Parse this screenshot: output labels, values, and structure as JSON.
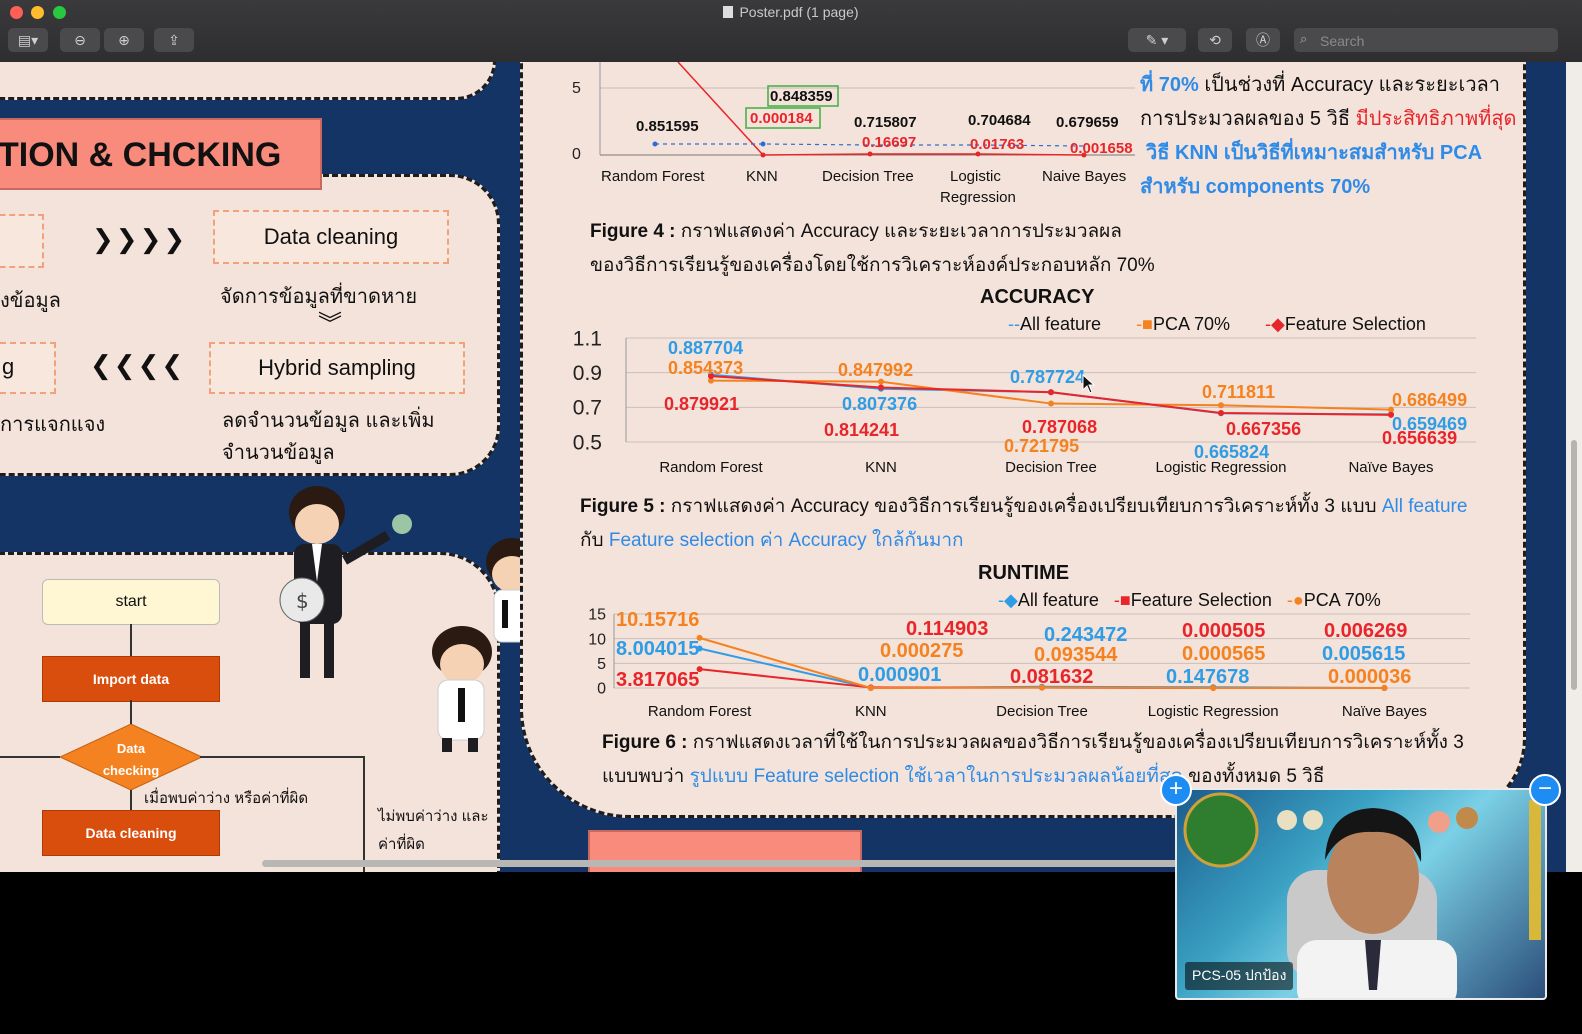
{
  "window": {
    "title": "Poster.pdf (1 page)",
    "search_placeholder": "Search"
  },
  "colors": {
    "accent_red": "#e8252a",
    "accent_blue": "#2e8be8",
    "pdf_navy": "#133464",
    "panel_bg": "#f4e3da",
    "orange": "#f58220",
    "flow_orange": "#d94e0d"
  },
  "left_panel": {
    "section_title": "TION & CHCKING",
    "arrows_right": "❯❯❯❯",
    "arrows_left": "❮❮❮❮",
    "data_cleaning_box": "Data cleaning",
    "data_cleaning_desc": "จัดการข้อมูลที่ขาดหาย",
    "hybrid_box": "Hybrid sampling",
    "hybrid_desc_1": "ลดจำนวนข้อมูล และเพิ่ม",
    "hybrid_desc_2": "จำนวนข้อมูล",
    "left_cut_1": "งข้อมูล",
    "left_cut_2": "g",
    "left_cut_3": "การแจกแจง"
  },
  "flowchart": {
    "start": "start",
    "import": "Import data",
    "checking": "Data checking",
    "found_label": "เมื่อพบค่าว่าง หรือค่าที่ผิด",
    "notfound_label_1": "ไม่พบค่าว่าง และ",
    "notfound_label_2": "ค่าที่ผิด",
    "cleaning": "Data cleaning"
  },
  "fig4": {
    "caption_bold": "Figure 4 :",
    "caption_1": " กราฟแสดงค่า Accuracy และระยะเวลาการประมวลผล",
    "caption_2": "ของวิธีการเรียนรู้ของเครื่องโดยใช้การวิเคราะห์องค์ประกอบหลัก 70%",
    "side_1_blue": "ที่ 70%",
    "side_1_black": " เป็นช่วงที่ Accuracy และระยะเวลา",
    "side_2_black": "การประมวลผลของ 5 วิธี ",
    "side_2_red": "มีประสิทธิภาพที่สุด",
    "side_3": "วิธี KNN เป็นวิธีที่เหมาะสมสำหรับ PCA",
    "side_4": "สำหรับ components 70%",
    "ytick_5": "5",
    "ytick_0": "0",
    "labels_black": [
      "0.851595",
      "0.848359",
      "0.715807",
      "0.704684",
      "0.679659"
    ],
    "labels_red": [
      "0.000184",
      "0.16697",
      "0.01763",
      "0.001658"
    ],
    "categories": [
      "Random Forest",
      "KNN",
      "Decision Tree",
      "Logistic",
      "Naive Bayes"
    ],
    "cat_extra": "Regression"
  },
  "fig5": {
    "title": "ACCURACY",
    "caption_bold": "Figure 5 :",
    "caption_1": " กราฟแสดงค่า Accuracy ของวิธีการเรียนรู้ของเครื่องเปรียบเทียบการวิเคราะห์ทั้ง 3 แบบ ",
    "caption_1_blue": "All feature",
    "caption_2_black": "กับ ",
    "caption_2_blue": "Feature selection ค่า Accuracy ใกล้กันมาก"
  },
  "fig6": {
    "title": "RUNTIME",
    "caption_bold": "Figure 6 :",
    "caption_1": " กราฟแสดงเวลาที่ใช้ในการประมวลผลของวิธีการเรียนรู้ของเครื่องเปรียบเทียบการวิเคราะห์ทั้ง 3",
    "caption_2_black": "แบบพบว่า ",
    "caption_2_blue": "รูปแบบ Feature selection ใช้เวลาในการประมวลผลน้อยที่สุด",
    "caption_2_end": " ของทั้งหมด 5 วิธี"
  },
  "chart_data": [
    {
      "type": "line",
      "title": "ACCURACY",
      "categories": [
        "Random Forest",
        "KNN",
        "Decision Tree",
        "Logistic Regression",
        "Naïve Bayes"
      ],
      "ylim": [
        0.5,
        1.1
      ],
      "yticks": [
        "1.1",
        "0.9",
        "0.7",
        "0.5"
      ],
      "legend_position": "top-right",
      "series": [
        {
          "name": "All feature",
          "color": "#2e9de6",
          "values": [
            0.887704,
            0.807376,
            0.787724,
            0.665824,
            0.659469
          ]
        },
        {
          "name": "PCA 70%",
          "color": "#f58220",
          "values": [
            0.854373,
            0.847992,
            0.721795,
            0.711811,
            0.686499
          ]
        },
        {
          "name": "Feature Selection",
          "color": "#e8252a",
          "values": [
            0.879921,
            0.814241,
            0.787068,
            0.667356,
            0.656639
          ]
        }
      ]
    },
    {
      "type": "line",
      "title": "RUNTIME",
      "categories": [
        "Random Forest",
        "KNN",
        "Decision Tree",
        "Logistic Regression",
        "Naïve Bayes"
      ],
      "ylim": [
        0,
        15
      ],
      "yticks": [
        "15",
        "10",
        "5",
        "0"
      ],
      "legend_position": "top-right",
      "series": [
        {
          "name": "All feature",
          "color": "#2e9de6",
          "values": [
            8.004015,
            0.000901,
            0.243472,
            0.147678,
            0.005615
          ]
        },
        {
          "name": "Feature Selection",
          "color": "#e8252a",
          "values": [
            3.817065,
            0.114903,
            0.081632,
            0.000505,
            0.006269
          ]
        },
        {
          "name": "PCA 70%",
          "color": "#f58220",
          "values": [
            10.15716,
            0.000275,
            0.093544,
            0.000565,
            3.6e-05
          ]
        }
      ]
    }
  ],
  "value_labels": {
    "acc": [
      "0.887704",
      "0.854373",
      "0.879921",
      "0.847992",
      "0.807376",
      "0.814241",
      "0.787724",
      "0.787068",
      "0.721795",
      "0.711811",
      "0.667356",
      "0.665824",
      "0.686499",
      "0.659469",
      "0.656639"
    ],
    "run": [
      "10.15716",
      "8.004015",
      "3.817065",
      "0.114903",
      "0.000275",
      "0.000901",
      "0.243472",
      "0.093544",
      "0.081632",
      "0.000505",
      "0.000565",
      "0.147678",
      "0.006269",
      "0.005615",
      "0.000036"
    ]
  },
  "webcam": {
    "label": "PCS-05 ปกป้อง"
  }
}
